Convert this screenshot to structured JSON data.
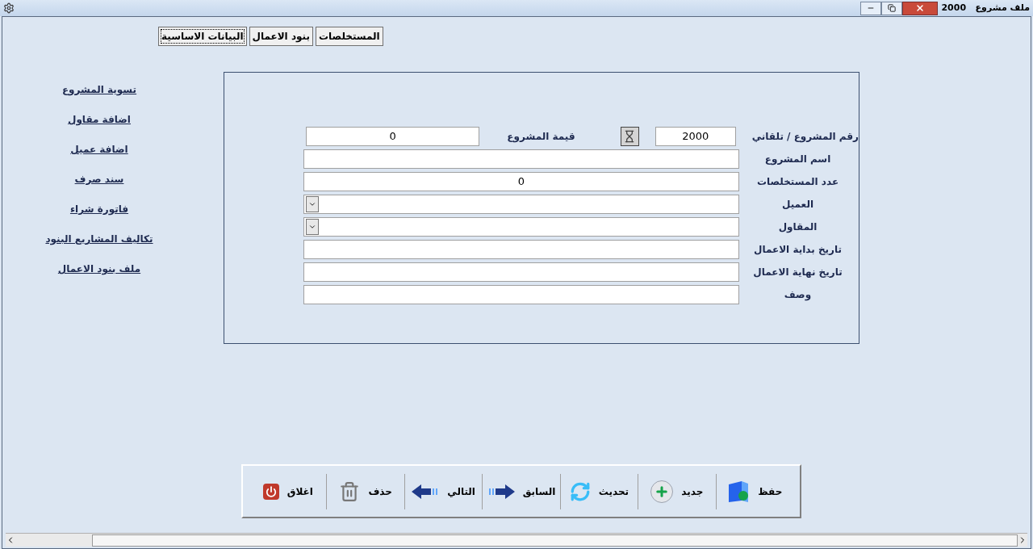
{
  "window": {
    "title": "ملف مشروع",
    "record": "2000"
  },
  "tabs": [
    {
      "label": "المستخلصات",
      "selected": false
    },
    {
      "label": "بنود الاعمال",
      "selected": false
    },
    {
      "label": "البيانات الاساسية",
      "selected": true
    }
  ],
  "sidebar": {
    "links": [
      "تسوية المشروع",
      "اضافة مقاول",
      "اضافة عميل",
      "سند صرف",
      "فاتورة شراء",
      "تكاليف المشاريع البنود",
      "ملف بنود الاعمال"
    ]
  },
  "form": {
    "project_number": {
      "label": "رقم المشروع / تلقاني",
      "value": "2000"
    },
    "project_value": {
      "label": "قيمة المشروع",
      "value": "0"
    },
    "fields": [
      {
        "kind": "text",
        "label": "اسم المشروع"
      },
      {
        "kind": "text",
        "label": "عدد المستخلصات",
        "value": "0"
      },
      {
        "kind": "combo",
        "label": "العميل"
      },
      {
        "kind": "combo",
        "label": "المقاول"
      },
      {
        "kind": "text",
        "label": "تاريخ بداية الاعمال"
      },
      {
        "kind": "text",
        "label": "تاريخ نهاية الاعمال"
      },
      {
        "kind": "text",
        "label": "وصف"
      }
    ]
  },
  "toolbar": [
    {
      "kind": "save",
      "label": "حفظ"
    },
    {
      "kind": "new",
      "label": "جديد"
    },
    {
      "kind": "refresh",
      "label": "تحديث"
    },
    {
      "kind": "previous",
      "label": "السابق"
    },
    {
      "kind": "next",
      "label": "التالي"
    },
    {
      "kind": "delete",
      "label": "حذف"
    },
    {
      "kind": "close",
      "label": "اغلاق"
    }
  ]
}
